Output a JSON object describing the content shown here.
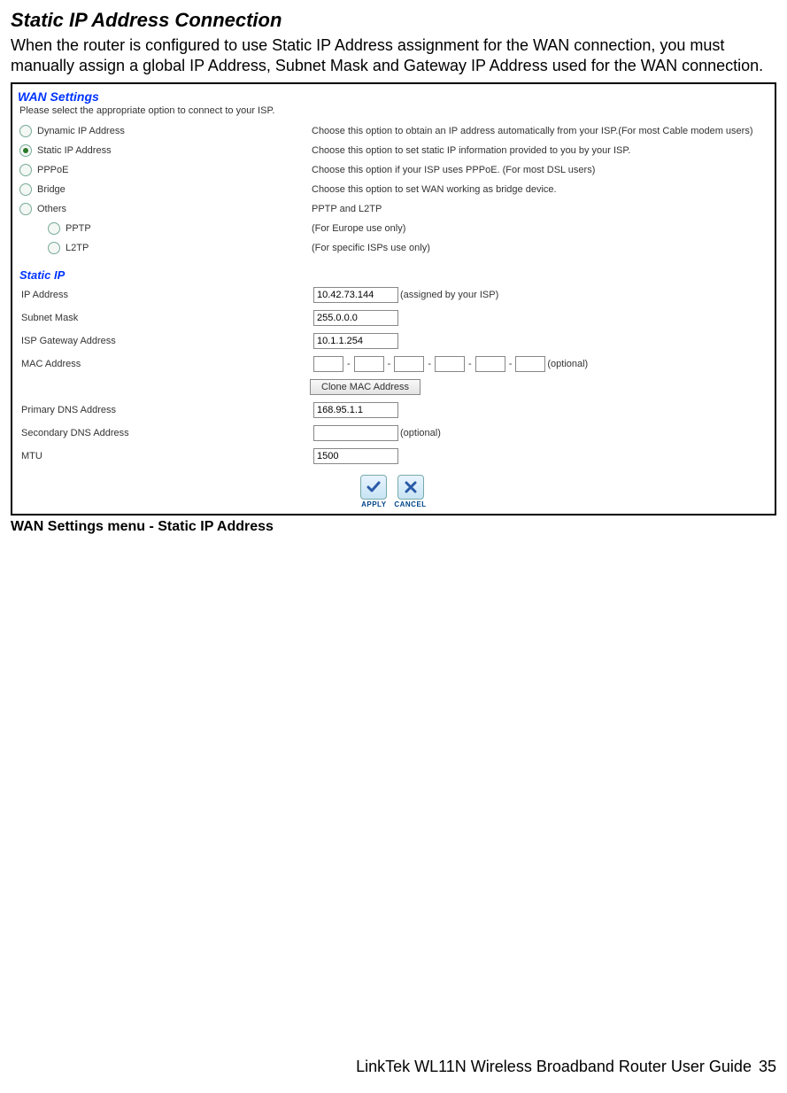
{
  "doc": {
    "title": "Static IP Address Connection",
    "paragraph": "When the router is configured to use Static IP Address assignment for the WAN connection, you must manually assign a global IP Address, Subnet Mask and Gateway IP Address used for the WAN connection.",
    "caption": "WAN Settings menu - Static IP Address",
    "footer_text": "LinkTek WL11N Wireless Broadband Router User Guide",
    "page_number": "35"
  },
  "panel": {
    "wan_settings_title": "WAN Settings",
    "please_select": "Please select the appropriate option to connect to your ISP.",
    "options": {
      "dynamic": {
        "label": "Dynamic IP Address",
        "desc": "Choose this option to obtain an IP address automatically from your ISP.(For most Cable modem users)"
      },
      "static": {
        "label": "Static IP Address",
        "desc": "Choose this option to set static IP information provided to you by your ISP."
      },
      "pppoe": {
        "label": "PPPoE",
        "desc": "Choose this option if your ISP uses PPPoE. (For most DSL users)"
      },
      "bridge": {
        "label": "Bridge",
        "desc": "Choose this option to set WAN working as bridge device."
      },
      "others": {
        "label": "Others",
        "desc": "PPTP and L2TP"
      },
      "pptp": {
        "label": "PPTP",
        "desc": "(For Europe use only)"
      },
      "l2tp": {
        "label": "L2TP",
        "desc": "(For specific ISPs use only)"
      }
    },
    "static_ip_title": "Static IP",
    "fields": {
      "ip_address": {
        "label": "IP Address",
        "value": "10.42.73.144",
        "after": "(assigned by your ISP)"
      },
      "subnet_mask": {
        "label": "Subnet Mask",
        "value": "255.0.0.0"
      },
      "isp_gateway": {
        "label": "ISP Gateway Address",
        "value": "10.1.1.254"
      },
      "mac_address": {
        "label": "MAC Address",
        "after": "(optional)"
      },
      "clone_btn": "Clone MAC Address",
      "primary_dns": {
        "label": "Primary DNS Address",
        "value": "168.95.1.1"
      },
      "secondary_dns": {
        "label": "Secondary DNS Address",
        "value": "",
        "after": "(optional)"
      },
      "mtu": {
        "label": "MTU",
        "value": "1500"
      }
    },
    "buttons": {
      "apply": "APPLY",
      "cancel": "CANCEL"
    }
  }
}
